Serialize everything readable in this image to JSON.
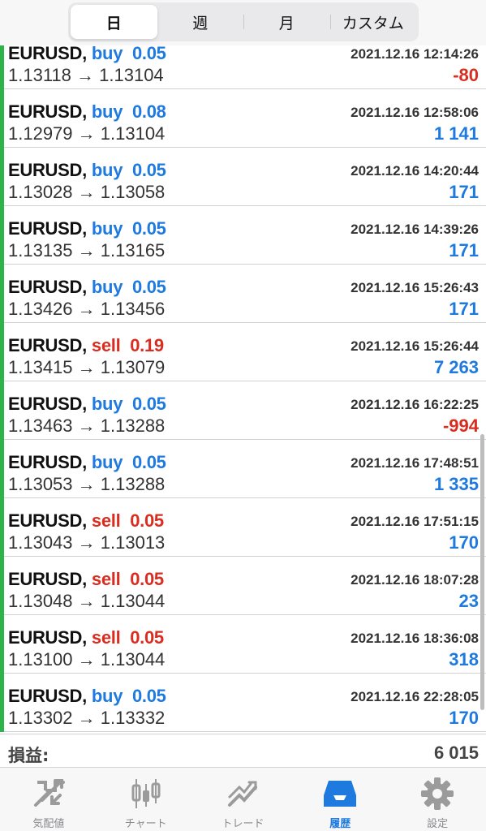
{
  "segments": [
    "日",
    "週",
    "月",
    "カスタム"
  ],
  "active_segment": "日",
  "trades": [
    {
      "symbol": "EURUSD",
      "dir": "buy",
      "lots": "0.05",
      "time": "2021.12.16 12:14:26",
      "open": "1.13118",
      "close": "1.13104",
      "profit": "-80"
    },
    {
      "symbol": "EURUSD",
      "dir": "buy",
      "lots": "0.08",
      "time": "2021.12.16 12:58:06",
      "open": "1.12979",
      "close": "1.13104",
      "profit": "1 141"
    },
    {
      "symbol": "EURUSD",
      "dir": "buy",
      "lots": "0.05",
      "time": "2021.12.16 14:20:44",
      "open": "1.13028",
      "close": "1.13058",
      "profit": "171"
    },
    {
      "symbol": "EURUSD",
      "dir": "buy",
      "lots": "0.05",
      "time": "2021.12.16 14:39:26",
      "open": "1.13135",
      "close": "1.13165",
      "profit": "171"
    },
    {
      "symbol": "EURUSD",
      "dir": "buy",
      "lots": "0.05",
      "time": "2021.12.16 15:26:43",
      "open": "1.13426",
      "close": "1.13456",
      "profit": "171"
    },
    {
      "symbol": "EURUSD",
      "dir": "sell",
      "lots": "0.19",
      "time": "2021.12.16 15:26:44",
      "open": "1.13415",
      "close": "1.13079",
      "profit": "7 263"
    },
    {
      "symbol": "EURUSD",
      "dir": "buy",
      "lots": "0.05",
      "time": "2021.12.16 16:22:25",
      "open": "1.13463",
      "close": "1.13288",
      "profit": "-994"
    },
    {
      "symbol": "EURUSD",
      "dir": "buy",
      "lots": "0.05",
      "time": "2021.12.16 17:48:51",
      "open": "1.13053",
      "close": "1.13288",
      "profit": "1 335"
    },
    {
      "symbol": "EURUSD",
      "dir": "sell",
      "lots": "0.05",
      "time": "2021.12.16 17:51:15",
      "open": "1.13043",
      "close": "1.13013",
      "profit": "170"
    },
    {
      "symbol": "EURUSD",
      "dir": "sell",
      "lots": "0.05",
      "time": "2021.12.16 18:07:28",
      "open": "1.13048",
      "close": "1.13044",
      "profit": "23"
    },
    {
      "symbol": "EURUSD",
      "dir": "sell",
      "lots": "0.05",
      "time": "2021.12.16 18:36:08",
      "open": "1.13100",
      "close": "1.13044",
      "profit": "318"
    },
    {
      "symbol": "EURUSD",
      "dir": "buy",
      "lots": "0.05",
      "time": "2021.12.16 22:28:05",
      "open": "1.13302",
      "close": "1.13332",
      "profit": "170"
    }
  ],
  "total": {
    "label": "損益:",
    "value": "6 015"
  },
  "tabs": [
    {
      "label": "気配値",
      "icon": "quotes-icon"
    },
    {
      "label": "チャート",
      "icon": "chart-candles-icon"
    },
    {
      "label": "トレード",
      "icon": "trade-icon"
    },
    {
      "label": "履歴",
      "icon": "history-inbox-icon"
    },
    {
      "label": "設定",
      "icon": "settings-gear-icon"
    }
  ],
  "active_tab": "履歴",
  "colors": {
    "buy": "#1f7ae0",
    "sell": "#d92d20",
    "indicator": "#2db34a",
    "active_tab": "#1f7ae0",
    "inactive_tab": "#8a8a8e"
  }
}
